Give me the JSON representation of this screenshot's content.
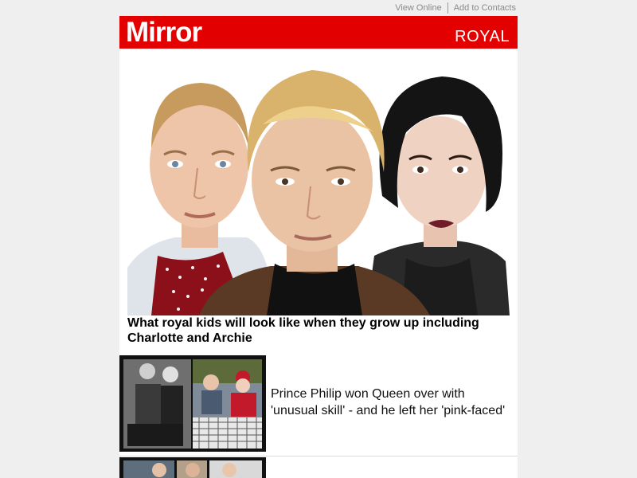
{
  "top_links": {
    "view_online": "View Online",
    "add_contacts": "Add to Contacts"
  },
  "masthead": {
    "logo": "Mirror",
    "section": "ROYAL",
    "brand_color": "#e20000"
  },
  "hero": {
    "title": "What royal kids will look like when they grow up including Charlotte and Archie"
  },
  "articles": [
    {
      "title": "Prince Philip won Queen over with 'unusual skill' - and he left her 'pink-faced'"
    }
  ]
}
